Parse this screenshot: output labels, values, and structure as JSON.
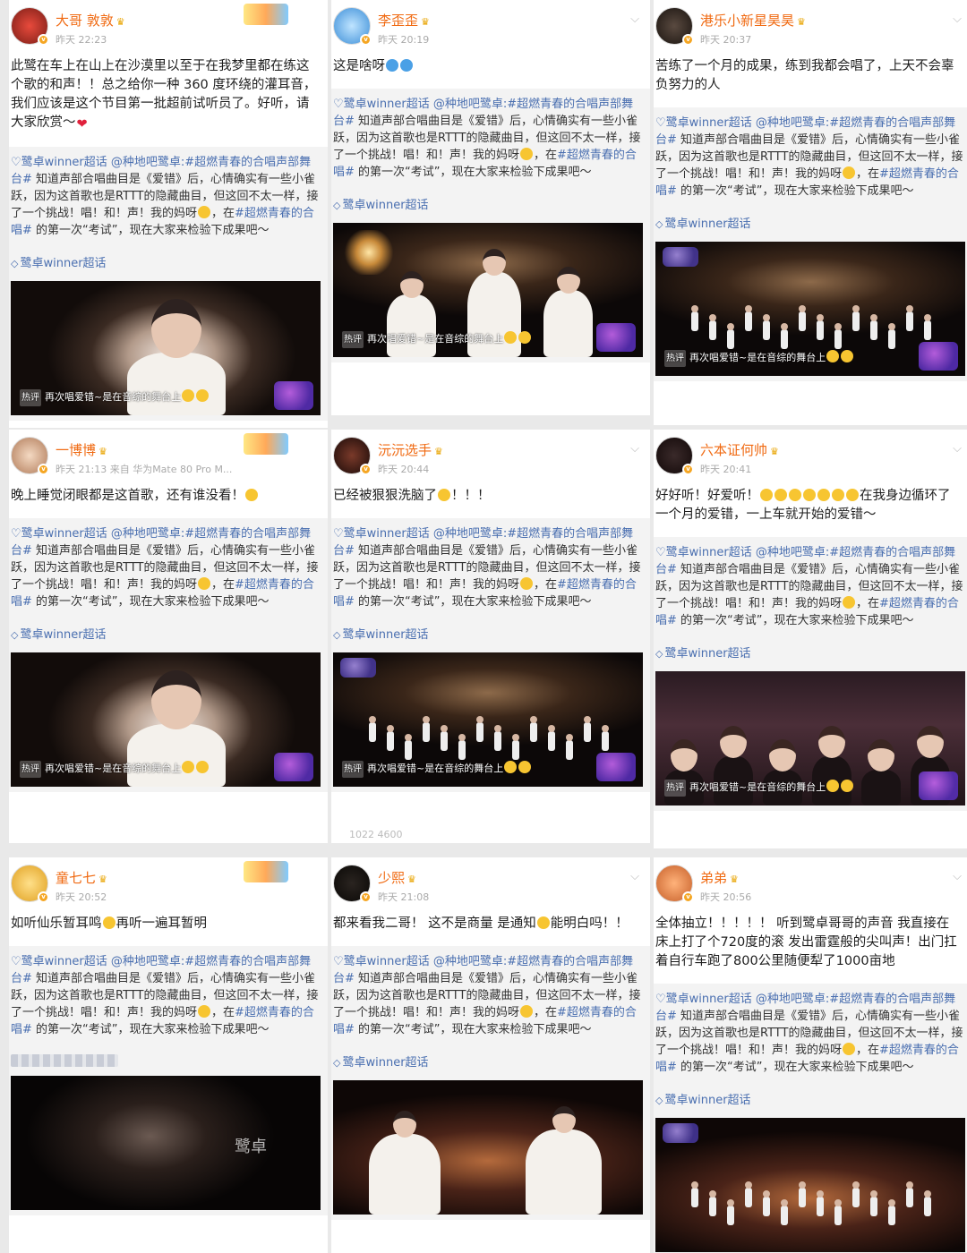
{
  "repost": {
    "tag1": "♡鹭卓winner超话",
    "mention": "@种地吧鹭卓",
    "tag2": ":#超燃青春的合唱声部舞台#",
    "body": "知道声部合唱曲目是《爱错》后，心情确实有一些小雀跃，因为这首歌也是RTTT的隐藏曲目，但这回不太一样，接了一个挑战！唱！和！声！我的妈呀",
    "tag3": "#超燃青春的合唱#",
    "tail_pre": "，在",
    "tail_post": "的第一次“考试”，现在大家来检验下成果吧～",
    "topic": "鹭卓winner超话"
  },
  "video_caption": {
    "hot_label": "热评",
    "text": "再次唱爱错~是在音综的舞台上"
  },
  "cards": [
    {
      "username": "大哥 敦敦",
      "meta": "昨天 22:23",
      "text": "此鹭在车上在山上在沙漠里以至于在我梦里都在练这个歌的和声！！总之给你一种 360 度环绕的灌耳音，我们应该是这个节目第一批超前试听员了。好听，请大家欣赏～",
      "emoji": "red-heart"
    },
    {
      "username": "李歪歪",
      "meta": "昨天 20:19",
      "text": "这是啥呀",
      "emoji": "sad-faces"
    },
    {
      "username": "港乐小新星昊昊",
      "meta": "昨天 20:37",
      "text": "苦练了一个月的成果，练到我都会唱了，上天不会辜负努力的人",
      "emoji": ""
    },
    {
      "username": "一博博",
      "meta": "昨天 21:13  来自 华为Mate 80 Pro M...",
      "text": "晚上睡觉闭眼都是这首歌，还有谁没看！",
      "emoji": "clap"
    },
    {
      "username": "沅沅选手",
      "meta": "昨天 20:44",
      "text": "已经被狠狠洗脑了",
      "tail": "！！！",
      "emoji": "grin"
    },
    {
      "username": "六本证何帅",
      "meta": "昨天 20:41",
      "text": "好好听！好爱听！",
      "text2": "在我身边循环了一个月的爱错，一上车就开始的爱错～",
      "emoji": "row"
    },
    {
      "username": "童七七",
      "meta": "昨天 20:52",
      "text": "如听仙乐暂耳鸣",
      "text2": "再听一遍耳暂明",
      "emoji": "mid"
    },
    {
      "username": "少熙",
      "meta": "昨天 21:08",
      "text": "都来看我二哥！ 这不是商量 是通知",
      "text2": "能明白吗！！",
      "emoji": "mid"
    },
    {
      "username": "弟弟",
      "meta": "昨天 20:56",
      "text": "全体抽立！！！！！ 听到鹭卓哥哥的声音 我直接在床上打了个720度的滚 发出雷霆般的尖叫声！出门扛着自行车跑了800公里随便犁了1000亩地",
      "emoji": ""
    }
  ],
  "watermark": "鹭卓",
  "counts_text": "1022   4600",
  "icons": [
    "chevron-down-icon",
    "vip-crown-icon",
    "verified-badge-icon",
    "diamond-icon"
  ]
}
